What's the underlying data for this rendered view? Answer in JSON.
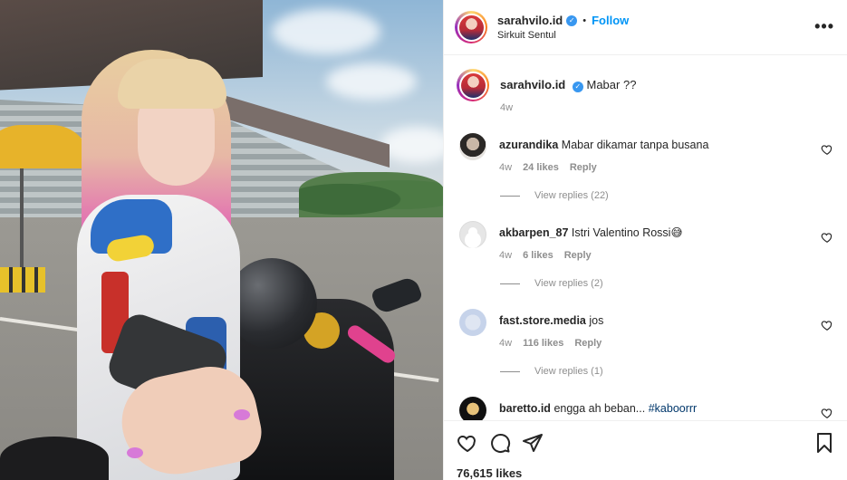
{
  "post": {
    "username": "sarahvilo.id",
    "separator": "•",
    "follow_label": "Follow",
    "location": "Sirkuit Sentul",
    "more_label": "•••",
    "caption": {
      "username": "sarahvilo.id",
      "text": "Mabar ??",
      "time": "4w"
    }
  },
  "comments": [
    {
      "username": "azurandika",
      "text": "Mabar dikamar tanpa busana",
      "time": "4w",
      "likes": "24 likes",
      "reply": "Reply",
      "view_replies": "View replies (22)"
    },
    {
      "username": "akbarpen_87",
      "text": "Istri Valentino Rossi😅",
      "time": "4w",
      "likes": "6 likes",
      "reply": "Reply",
      "view_replies": "View replies (2)"
    },
    {
      "username": "fast.store.media",
      "text": "jos",
      "time": "4w",
      "likes": "116 likes",
      "reply": "Reply",
      "view_replies": "View replies (1)"
    },
    {
      "username": "baretto.id",
      "text": "engga ah beban...",
      "hashtag": "#kaboorrr"
    }
  ],
  "footer": {
    "likes": "76,615 likes"
  },
  "icons": {
    "heart": "heart-icon",
    "comment": "comment-icon",
    "share": "paper-plane-icon",
    "save": "bookmark-icon",
    "verified": "verified-badge-icon",
    "more": "more-options-icon"
  },
  "colors": {
    "follow": "#0095f6",
    "verified": "#3897f0",
    "muted": "#8e8e8e",
    "hashtag": "#00376b"
  }
}
